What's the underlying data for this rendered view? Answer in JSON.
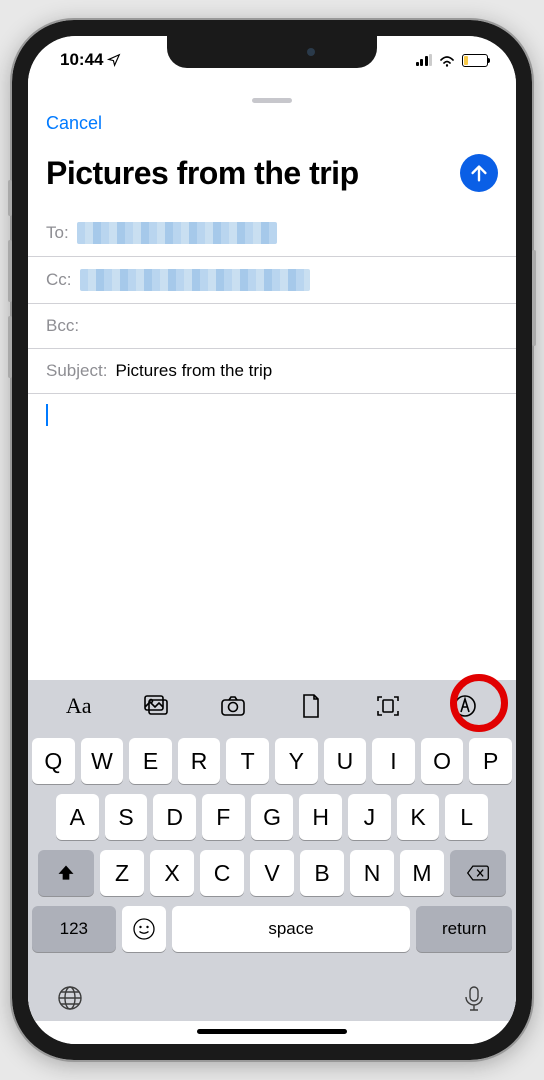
{
  "status": {
    "time": "10:44",
    "location_arrow": "➤"
  },
  "nav": {
    "cancel_label": "Cancel"
  },
  "compose": {
    "title": "Pictures from the trip",
    "fields": {
      "to_label": "To:",
      "cc_label": "Cc:",
      "bcc_label": "Bcc:",
      "subject_label": "Subject:",
      "subject_value": "Pictures from the trip"
    }
  },
  "keyboard": {
    "row1": [
      "Q",
      "W",
      "E",
      "R",
      "T",
      "Y",
      "U",
      "I",
      "O",
      "P"
    ],
    "row2": [
      "A",
      "S",
      "D",
      "F",
      "G",
      "H",
      "J",
      "K",
      "L"
    ],
    "row3": [
      "Z",
      "X",
      "C",
      "V",
      "B",
      "N",
      "M"
    ],
    "numeric_label": "123",
    "space_label": "space",
    "return_label": "return"
  },
  "toolbar_icons": [
    "text-format",
    "photo-library",
    "camera",
    "document",
    "scan-document",
    "markup"
  ]
}
